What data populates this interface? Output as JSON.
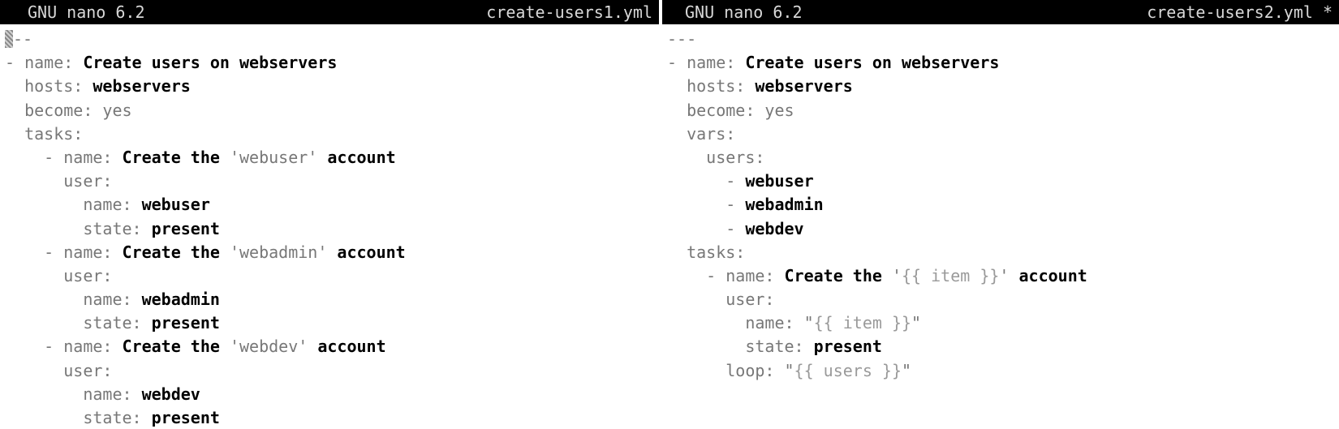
{
  "left": {
    "title_app": "GNU nano 6.2",
    "title_file": "create-users1.yml",
    "lines": [
      [
        {
          "t": "cursor"
        },
        {
          "c": "k",
          "x": "--"
        }
      ],
      [
        {
          "c": "k",
          "x": "- name: "
        },
        {
          "c": "v",
          "x": "Create users on webservers"
        }
      ],
      [
        {
          "c": "k",
          "x": "  hosts: "
        },
        {
          "c": "v",
          "x": "webservers"
        }
      ],
      [
        {
          "c": "k",
          "x": "  become: yes"
        }
      ],
      [
        {
          "c": "k",
          "x": "  tasks:"
        }
      ],
      [
        {
          "c": "k",
          "x": "    - name: "
        },
        {
          "c": "v",
          "x": "Create the "
        },
        {
          "c": "s",
          "x": "'webuser'"
        },
        {
          "c": "v",
          "x": " account"
        }
      ],
      [
        {
          "c": "k",
          "x": "      user:"
        }
      ],
      [
        {
          "c": "k",
          "x": "        name: "
        },
        {
          "c": "v",
          "x": "webuser"
        }
      ],
      [
        {
          "c": "k",
          "x": "        state: "
        },
        {
          "c": "v",
          "x": "present"
        }
      ],
      [
        {
          "c": "k",
          "x": "    - name: "
        },
        {
          "c": "v",
          "x": "Create the "
        },
        {
          "c": "s",
          "x": "'webadmin'"
        },
        {
          "c": "v",
          "x": " account"
        }
      ],
      [
        {
          "c": "k",
          "x": "      user:"
        }
      ],
      [
        {
          "c": "k",
          "x": "        name: "
        },
        {
          "c": "v",
          "x": "webadmin"
        }
      ],
      [
        {
          "c": "k",
          "x": "        state: "
        },
        {
          "c": "v",
          "x": "present"
        }
      ],
      [
        {
          "c": "k",
          "x": "    - name: "
        },
        {
          "c": "v",
          "x": "Create the "
        },
        {
          "c": "s",
          "x": "'webdev'"
        },
        {
          "c": "v",
          "x": " account"
        }
      ],
      [
        {
          "c": "k",
          "x": "      user:"
        }
      ],
      [
        {
          "c": "k",
          "x": "        name: "
        },
        {
          "c": "v",
          "x": "webdev"
        }
      ],
      [
        {
          "c": "k",
          "x": "        state: "
        },
        {
          "c": "v",
          "x": "present"
        }
      ]
    ]
  },
  "right": {
    "title_app": "GNU nano 6.2",
    "title_file": "create-users2.yml *",
    "lines": [
      [
        {
          "c": "k",
          "x": "---"
        }
      ],
      [
        {
          "c": "k",
          "x": "- name: "
        },
        {
          "c": "v",
          "x": "Create users on webservers"
        }
      ],
      [
        {
          "c": "k",
          "x": "  hosts: "
        },
        {
          "c": "v",
          "x": "webservers"
        }
      ],
      [
        {
          "c": "k",
          "x": "  become: yes"
        }
      ],
      [
        {
          "c": "k",
          "x": "  vars:"
        }
      ],
      [
        {
          "c": "k",
          "x": "    users:"
        }
      ],
      [
        {
          "c": "k",
          "x": "      - "
        },
        {
          "c": "v",
          "x": "webuser"
        }
      ],
      [
        {
          "c": "k",
          "x": "      - "
        },
        {
          "c": "v",
          "x": "webadmin"
        }
      ],
      [
        {
          "c": "k",
          "x": "      - "
        },
        {
          "c": "v",
          "x": "webdev"
        }
      ],
      [
        {
          "c": "k",
          "x": "  tasks:"
        }
      ],
      [
        {
          "c": "k",
          "x": "    - name: "
        },
        {
          "c": "v",
          "x": "Create the "
        },
        {
          "c": "s",
          "x": "'"
        },
        {
          "c": "tpl",
          "x": "{{ item }}"
        },
        {
          "c": "s",
          "x": "'"
        },
        {
          "c": "v",
          "x": " account"
        }
      ],
      [
        {
          "c": "k",
          "x": "      user:"
        }
      ],
      [
        {
          "c": "k",
          "x": "        name: \""
        },
        {
          "c": "tpl",
          "x": "{{ item }}"
        },
        {
          "c": "k",
          "x": "\""
        }
      ],
      [
        {
          "c": "k",
          "x": "        state: "
        },
        {
          "c": "v",
          "x": "present"
        }
      ],
      [
        {
          "c": "k",
          "x": "      loop: \""
        },
        {
          "c": "tpl",
          "x": "{{ users }}"
        },
        {
          "c": "k",
          "x": "\""
        }
      ]
    ]
  }
}
